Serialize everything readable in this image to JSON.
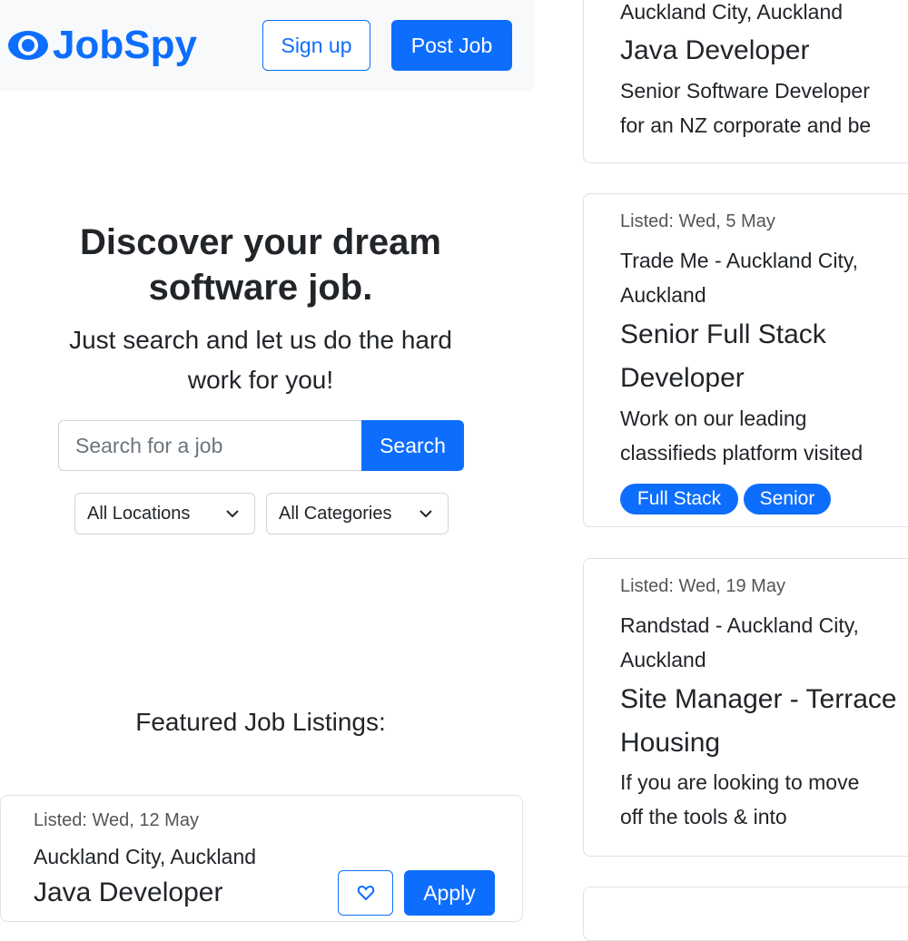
{
  "header": {
    "brand": "JobSpy",
    "signup_label": "Sign up",
    "post_job_label": "Post Job"
  },
  "hero": {
    "title_line1": "Discover your dream",
    "title_line2": "software job.",
    "subtitle_line1": "Just search and let us do the hard",
    "subtitle_line2": "work for you!"
  },
  "search": {
    "placeholder": "Search for a job",
    "button_label": "Search",
    "location_selected": "All Locations",
    "category_selected": "All Categories"
  },
  "featured": {
    "heading": "Featured Job Listings:",
    "first_card": {
      "listed": "Listed: Wed, 12 May",
      "company": "Auckland City, Auckland",
      "title": "Java Developer",
      "apply_label": "Apply"
    }
  },
  "right_column": {
    "card1": {
      "company": "Auckland City, Auckland",
      "title": "Java Developer",
      "desc_line1": "Senior Software Developer",
      "desc_line2": "for an NZ corporate and be"
    },
    "card2": {
      "listed": "Listed: Wed, 5 May",
      "company_line1": "Trade Me - Auckland City,",
      "company_line2": "Auckland",
      "title_line1": "Senior Full Stack",
      "title_line2": "Developer",
      "desc_line1": "Work on our leading",
      "desc_line2": "classifieds platform visited",
      "badges": [
        "Full Stack",
        "Senior"
      ]
    },
    "card3": {
      "listed": "Listed: Wed, 19 May",
      "company_line1": "Randstad - Auckland City,",
      "company_line2": "Auckland",
      "title_line1": "Site Manager - Terrace",
      "title_line2": "Housing",
      "desc_line1": "If you are looking to move",
      "desc_line2": "off the tools & into"
    }
  },
  "colors": {
    "primary": "#0d6efd",
    "header_bg": "#f8f9fa",
    "border": "#dee2e6"
  },
  "icons": [
    "eye-logo-icon",
    "chevron-down-icon",
    "heart-icon"
  ]
}
